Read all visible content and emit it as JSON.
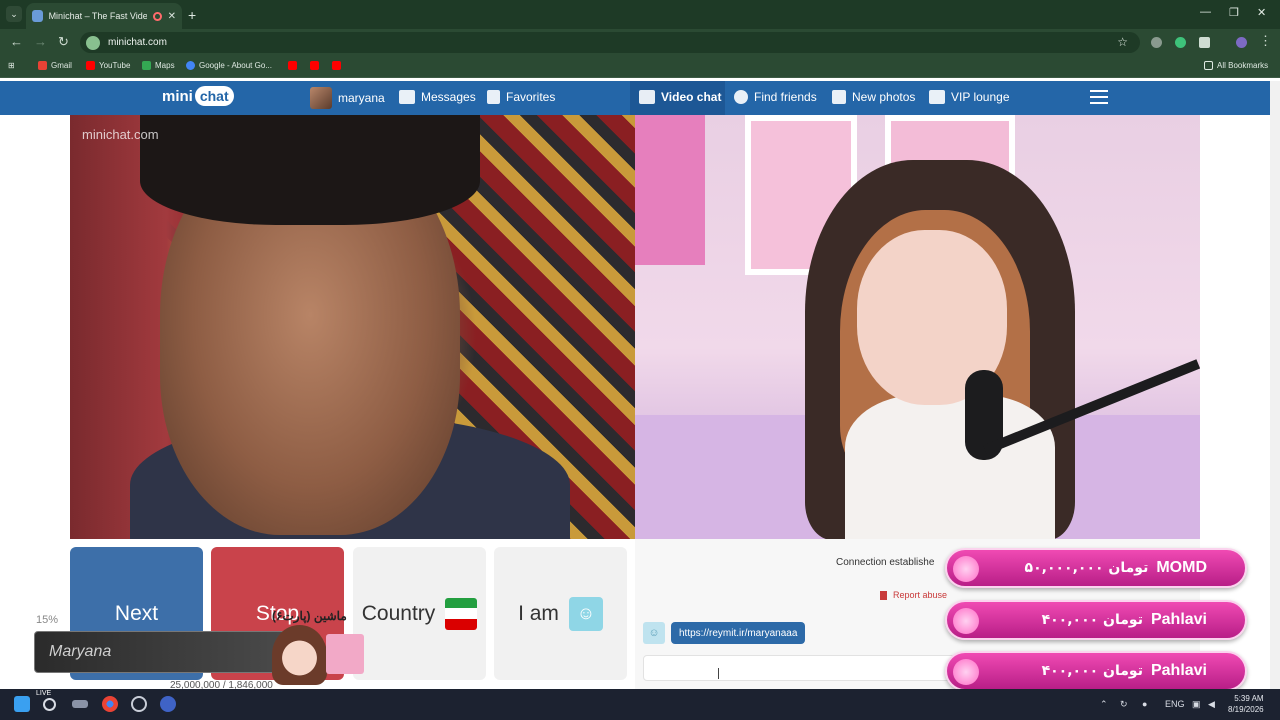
{
  "browser": {
    "tab_title": "Minichat – The Fast Video C",
    "url": "minichat.com",
    "bookmarks": [
      "Gmail",
      "YouTube",
      "Maps",
      "Google - About Go...",
      "All Bookmarks"
    ]
  },
  "site": {
    "logo_mini": "mini",
    "logo_chat": "chat",
    "nav": {
      "username": "maryana",
      "messages": "Messages",
      "favorites": "Favorites",
      "video_chat": "Video chat",
      "find_friends": "Find friends",
      "new_photos": "New photos",
      "vip_lounge": "VIP lounge"
    },
    "watermark": "minichat.com"
  },
  "controls": {
    "next": "Next",
    "stop": "Stop",
    "country": "Country",
    "i_am": "I am"
  },
  "chat": {
    "connection_status": "Connection establishe",
    "report_abuse": "Report abuse",
    "link_message": "https://reymit.ir/maryanaaa",
    "input_placeholder": ""
  },
  "donations": [
    {
      "amount": "۵۰,۰۰۰,۰۰۰ تومان",
      "name": "MOMD"
    },
    {
      "amount": "۴۰۰,۰۰۰ تومان",
      "name": "Pahlavi"
    },
    {
      "amount": "۴۰۰,۰۰۰ تومان",
      "name": "Pahlavi"
    }
  ],
  "stream_overlay": {
    "percent": "15%",
    "banner_text": "Maryana",
    "name_label": "ماشین (پارت۶)",
    "numbers": "25,000,000 / 1,846,000"
  },
  "taskbar": {
    "live": "LIVE",
    "lang": "ENG",
    "time": "5:39 AM",
    "date": "8/19/2026"
  },
  "colors": {
    "site_blue": "#2466a8",
    "next_button": "#3d6fa9",
    "stop_button": "#c9434b",
    "donation_pink": "#e43aa5"
  }
}
